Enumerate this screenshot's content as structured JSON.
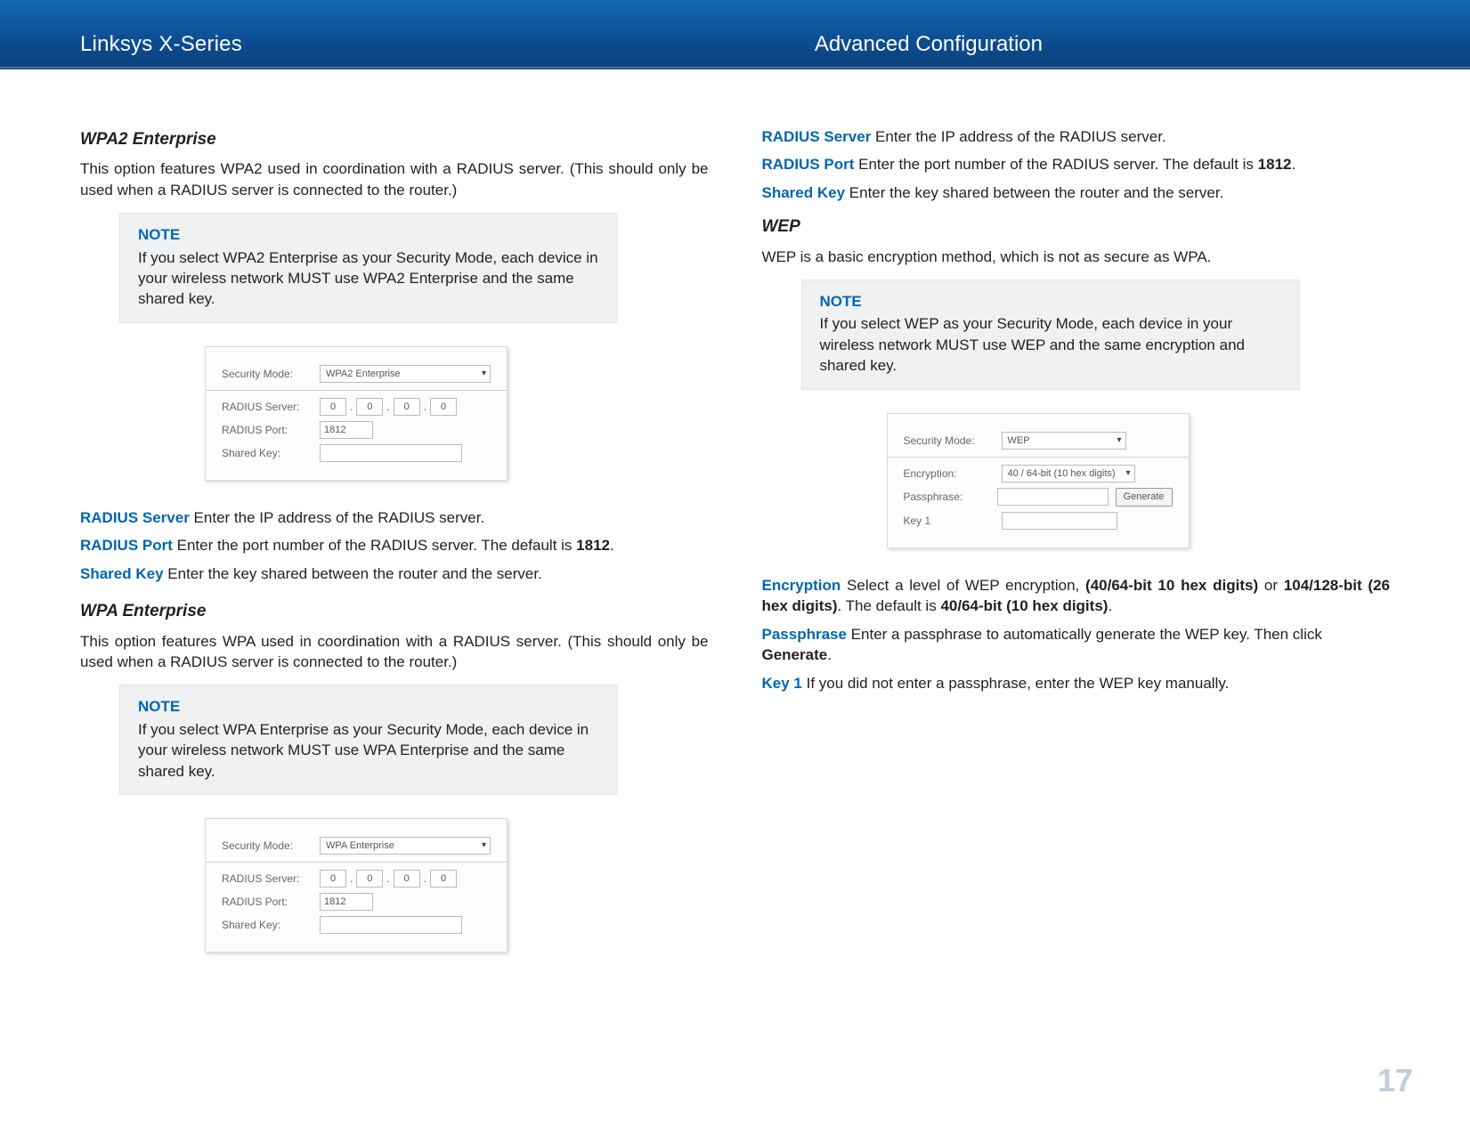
{
  "header": {
    "left": "Linksys X-Series",
    "right": "Advanced Configuration"
  },
  "page_number": "17",
  "left_col": {
    "wpa2_ent": {
      "heading": "WPA2 Enterprise",
      "intro": "This option features WPA2 used in coordination with a RADIUS server. (This should only be used when a RADIUS server is connected to the router.)",
      "note_title": "NOTE",
      "note_body": "If you select WPA2 Enterprise as your Security Mode, each device in your wireless network MUST use WPA2 Enterprise and the same shared key.",
      "shot": {
        "security_mode_label": "Security Mode:",
        "security_mode_value": "WPA2 Enterprise",
        "radius_server_label": "RADIUS Server:",
        "ip": [
          "0",
          "0",
          "0",
          "0"
        ],
        "radius_port_label": "RADIUS Port:",
        "radius_port_value": "1812",
        "shared_key_label": "Shared Key:"
      },
      "fields": {
        "radius_server_label": "RADIUS Server",
        "radius_server_text": "  Enter the IP address of the RADIUS server.",
        "radius_port_label": "RADIUS Port",
        "radius_port_text_a": "   Enter the port number of the RADIUS server. The default is ",
        "radius_port_text_b": "1812",
        "radius_port_text_c": ".",
        "shared_key_label": "Shared Key",
        "shared_key_text": "  Enter the key shared between the router and the server."
      }
    },
    "wpa_ent": {
      "heading": "WPA Enterprise",
      "intro": "This option features WPA used in coordination with a RADIUS server. (This should only be used when a RADIUS server is connected to the router.)",
      "note_title": "NOTE",
      "note_body": "If you select WPA Enterprise as your Security Mode, each device in your wireless network MUST use WPA Enterprise and the same shared key.",
      "shot": {
        "security_mode_label": "Security Mode:",
        "security_mode_value": "WPA Enterprise",
        "radius_server_label": "RADIUS Server:",
        "ip": [
          "0",
          "0",
          "0",
          "0"
        ],
        "radius_port_label": "RADIUS Port:",
        "radius_port_value": "1812",
        "shared_key_label": "Shared Key:"
      }
    }
  },
  "right_col": {
    "fields_top": {
      "radius_server_label": "RADIUS Server",
      "radius_server_text": "  Enter the IP address of the RADIUS server.",
      "radius_port_label": "RADIUS Port",
      "radius_port_text_a": "   Enter the port number of the RADIUS server. The default is ",
      "radius_port_text_b": "1812",
      "radius_port_text_c": ".",
      "shared_key_label": "Shared Key",
      "shared_key_text": "  Enter the key shared between the router and the server."
    },
    "wep": {
      "heading": "WEP",
      "intro": "WEP is a basic encryption method, which is not as secure as WPA.",
      "note_title": "NOTE",
      "note_body": "If you select WEP as your Security Mode, each device in your wireless network MUST use WEP and the same encryption and shared key.",
      "shot": {
        "security_mode_label": "Security Mode:",
        "security_mode_value": "WEP",
        "encryption_label": "Encryption:",
        "encryption_value": "40 / 64-bit (10 hex digits)",
        "passphrase_label": "Passphrase:",
        "generate_btn": "Generate",
        "key1_label": "Key 1"
      },
      "fields": {
        "encryption_label": "Encryption",
        "encryption_text_a": "  Select a level of WEP encryption, ",
        "encryption_text_b": "(40/64-bit 10 hex digits)",
        "encryption_text_c": " or ",
        "encryption_text_d": "104/128-bit (26 hex digits)",
        "encryption_text_e": ". The default is ",
        "encryption_text_f": "40/64-bit (10 hex digits)",
        "encryption_text_g": ".",
        "passphrase_label": "Passphrase",
        "passphrase_text_a": "  Enter a passphrase to automatically generate the WEP key. Then click ",
        "passphrase_text_b": "Generate",
        "passphrase_text_c": ".",
        "key1_label": "Key 1",
        "key1_text": "  If you did not enter a passphrase, enter the WEP key manually."
      }
    }
  }
}
